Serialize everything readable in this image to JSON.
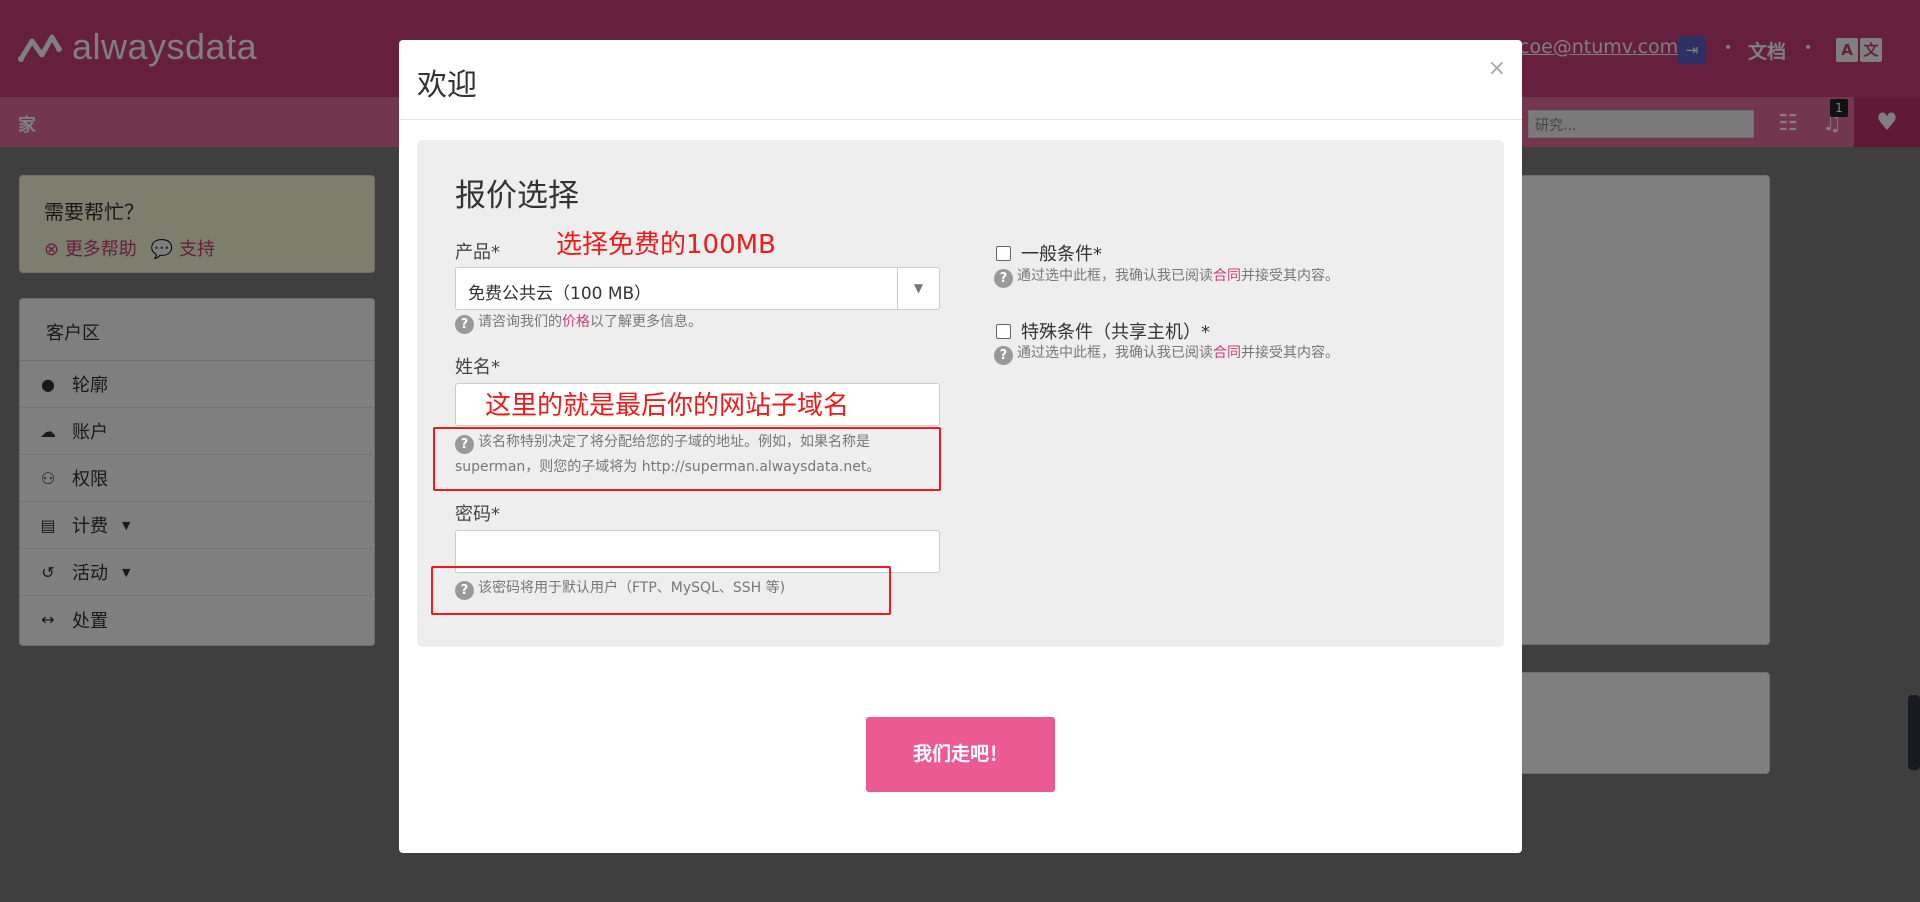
{
  "header": {
    "logo_text": "alwaysdata",
    "user_email": "coe@ntumv.com",
    "docs_label": "文档",
    "lang_left": "A",
    "lang_right": "文"
  },
  "nav": {
    "home_label": "家",
    "search_placeholder": "研究...",
    "notification_count": "1"
  },
  "help_panel": {
    "title": "需要帮忙？",
    "more_help": "更多帮助",
    "support": "支持"
  },
  "client_area": {
    "title": "客户区",
    "items": [
      {
        "label": "轮廓",
        "icon": "user-icon"
      },
      {
        "label": "账户",
        "icon": "cloud-icon"
      },
      {
        "label": "权限",
        "icon": "users-icon"
      },
      {
        "label": "计费",
        "icon": "invoice-icon",
        "has_dropdown": true
      },
      {
        "label": "活动",
        "icon": "history-icon",
        "has_dropdown": true
      },
      {
        "label": "处置",
        "icon": "arrows-h-icon"
      }
    ]
  },
  "modal": {
    "title": "欢迎",
    "close_glyph": "×",
    "section_title": "报价选择",
    "product": {
      "label": "产品*",
      "value": "免费公共云（100 MB）",
      "help_before": "请咨询我们的",
      "help_link": "价格",
      "help_after": "以了解更多信息。"
    },
    "name": {
      "label": "姓名*",
      "value": "",
      "help_line1": "该名称特别决定了将分配给您的子域的地址。例如，如果名称是",
      "help_line2": "superman，则您的子域将为 http://superman.alwaysdata.net。"
    },
    "password": {
      "label": "密码*",
      "value": "",
      "help": "该密码将用于默认用户（FTP、MySQL、SSH 等)"
    },
    "general_terms": {
      "label": "一般条件*",
      "checked": false,
      "help_before": "通过选中此框，我确认我已阅读",
      "help_link": "合同",
      "help_after": "并接受其内容。"
    },
    "special_terms": {
      "label": "特殊条件（共享主机）*",
      "checked": false,
      "help_before": "通过选中此框，我确认我已阅读",
      "help_link": "合同",
      "help_after": "并接受其内容。"
    },
    "submit_label": "我们走吧！"
  },
  "annotations": {
    "product_note": "选择免费的100MB",
    "name_note": "这里的就是最后你的网站子域名",
    "color": "#ee1b1b"
  },
  "colors": {
    "brand": "#cc3f7a",
    "button": "#ec5a93"
  }
}
